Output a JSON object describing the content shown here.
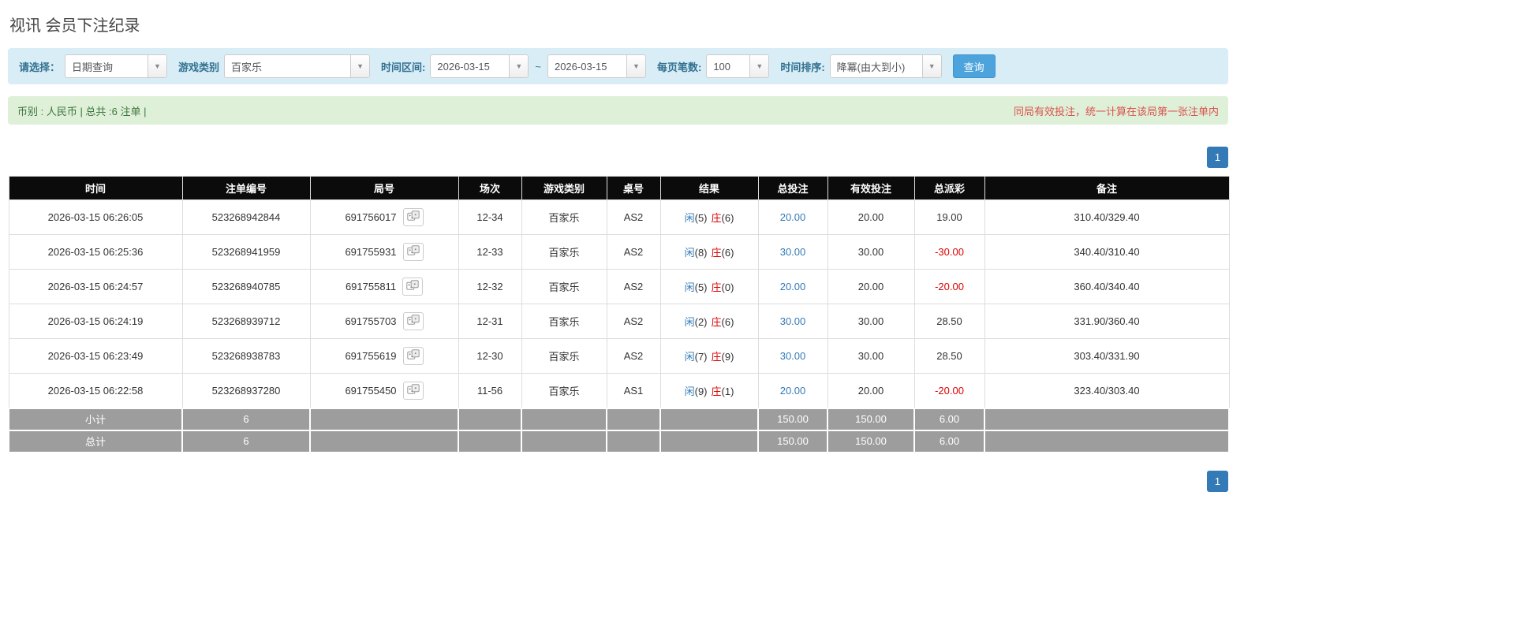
{
  "page": {
    "title": "视讯 会员下注纪录"
  },
  "filters": {
    "select_label": "请选择：",
    "select_value": "日期查询",
    "game_type_label": "游戏类别",
    "game_type_value": "百家乐",
    "date_range_label": "时间区间:",
    "date_from": "2026-03-15",
    "date_separator": "~",
    "date_to": "2026-03-15",
    "page_size_label": "每页笔数:",
    "page_size_value": "100",
    "sort_label": "时间排序:",
    "sort_value": "降冪(由大到小)",
    "search_button": "查询"
  },
  "summary": {
    "left": "币别 : 人民币 | 总共 :6 注单 |",
    "right": "同局有效投注，统一计算在该局第一张注单内"
  },
  "pagination": {
    "page": "1"
  },
  "table": {
    "headers": [
      "时间",
      "注单编号",
      "局号",
      "场次",
      "游戏类别",
      "桌号",
      "结果",
      "总投注",
      "有效投注",
      "总派彩",
      "备注"
    ],
    "rows": [
      {
        "time": "2026-03-15 06:26:05",
        "bet_id": "523268942844",
        "round_id": "691756017",
        "session": "12-34",
        "game": "百家乐",
        "table_no": "AS2",
        "result": {
          "player": "闲",
          "player_score": "(5)",
          "banker": "庄",
          "banker_score": "(6)"
        },
        "total_bet": "20.00",
        "valid_bet": "20.00",
        "payout": "19.00",
        "note": "310.40/329.40"
      },
      {
        "time": "2026-03-15 06:25:36",
        "bet_id": "523268941959",
        "round_id": "691755931",
        "session": "12-33",
        "game": "百家乐",
        "table_no": "AS2",
        "result": {
          "player": "闲",
          "player_score": "(8)",
          "banker": "庄",
          "banker_score": "(6)"
        },
        "total_bet": "30.00",
        "valid_bet": "30.00",
        "payout": "-30.00",
        "note": "340.40/310.40"
      },
      {
        "time": "2026-03-15 06:24:57",
        "bet_id": "523268940785",
        "round_id": "691755811",
        "session": "12-32",
        "game": "百家乐",
        "table_no": "AS2",
        "result": {
          "player": "闲",
          "player_score": "(5)",
          "banker": "庄",
          "banker_score": "(0)"
        },
        "total_bet": "20.00",
        "valid_bet": "20.00",
        "payout": "-20.00",
        "note": "360.40/340.40"
      },
      {
        "time": "2026-03-15 06:24:19",
        "bet_id": "523268939712",
        "round_id": "691755703",
        "session": "12-31",
        "game": "百家乐",
        "table_no": "AS2",
        "result": {
          "player": "闲",
          "player_score": "(2)",
          "banker": "庄",
          "banker_score": "(6)"
        },
        "total_bet": "30.00",
        "valid_bet": "30.00",
        "payout": "28.50",
        "note": "331.90/360.40"
      },
      {
        "time": "2026-03-15 06:23:49",
        "bet_id": "523268938783",
        "round_id": "691755619",
        "session": "12-30",
        "game": "百家乐",
        "table_no": "AS2",
        "result": {
          "player": "闲",
          "player_score": "(7)",
          "banker": "庄",
          "banker_score": "(9)"
        },
        "total_bet": "30.00",
        "valid_bet": "30.00",
        "payout": "28.50",
        "note": "303.40/331.90"
      },
      {
        "time": "2026-03-15 06:22:58",
        "bet_id": "523268937280",
        "round_id": "691755450",
        "session": "11-56",
        "game": "百家乐",
        "table_no": "AS1",
        "result": {
          "player": "闲",
          "player_score": "(9)",
          "banker": "庄",
          "banker_score": "(1)"
        },
        "total_bet": "20.00",
        "valid_bet": "20.00",
        "payout": "-20.00",
        "note": "323.40/303.40"
      }
    ],
    "subtotal": {
      "label": "小计",
      "count": "6",
      "total_bet": "150.00",
      "valid_bet": "150.00",
      "payout": "6.00"
    },
    "total": {
      "label": "总计",
      "count": "6",
      "total_bet": "150.00",
      "valid_bet": "150.00",
      "payout": "6.00"
    }
  }
}
